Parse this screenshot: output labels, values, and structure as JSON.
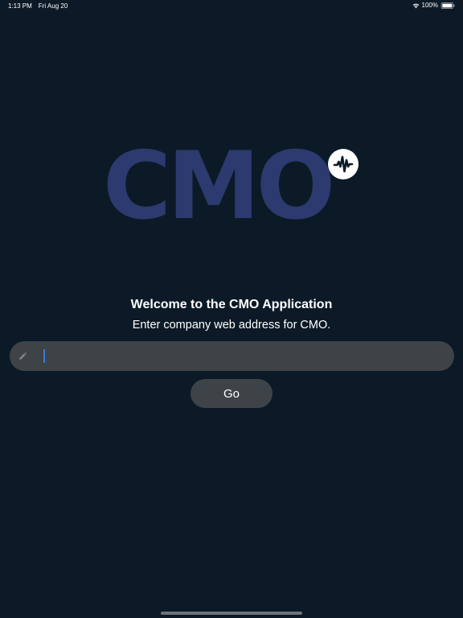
{
  "status_bar": {
    "time": "1:13 PM",
    "date": "Fri Aug 20",
    "battery_percent": "100%",
    "battery_level": 1.0,
    "wifi_icon": "wifi-icon",
    "battery_icon": "battery-icon"
  },
  "logo": {
    "text": "CMO",
    "color": "#2c3a70",
    "badge_icon": "pulse-waveform-icon"
  },
  "welcome": {
    "title": "Welcome to the CMO Application",
    "subtitle": "Enter company web address for CMO."
  },
  "url_field": {
    "value": "",
    "placeholder": "",
    "icon": "pencil-icon"
  },
  "go_button": {
    "label": "Go"
  },
  "colors": {
    "background": "#0c1a27",
    "field_background": "#3e4347",
    "caret": "#3a7bd5"
  }
}
